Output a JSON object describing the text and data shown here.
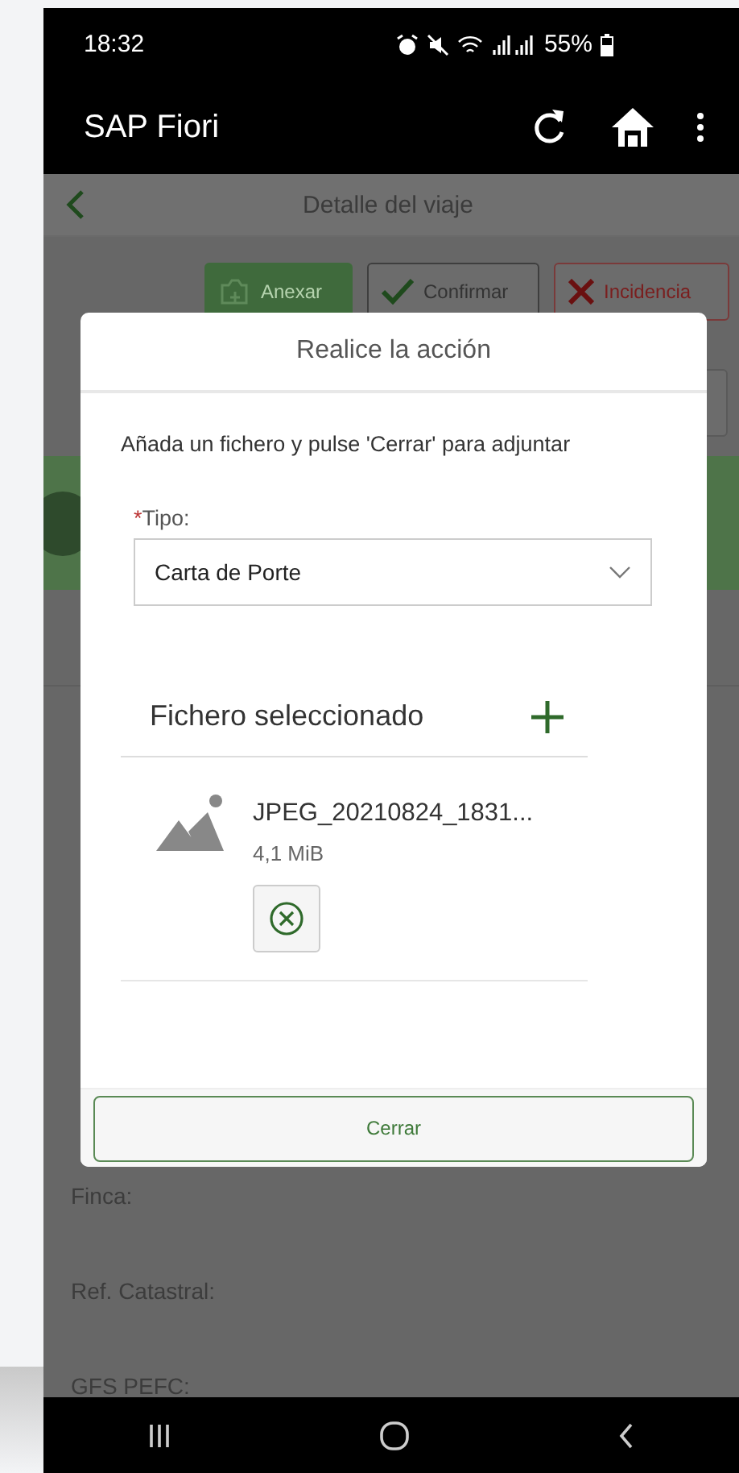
{
  "status_bar": {
    "time": "18:32",
    "battery": "55%"
  },
  "app_bar": {
    "title": "SAP Fiori"
  },
  "page": {
    "title": "Detalle del viaje",
    "actions": [
      {
        "label": "Anexar",
        "kind": "attach"
      },
      {
        "label": "Confirmar",
        "kind": "confirm"
      },
      {
        "label": "Incidencia",
        "kind": "incident"
      }
    ],
    "fields": [
      {
        "label": "Finca:"
      },
      {
        "label": "Ref. Catastral:"
      },
      {
        "label": "GFS PEFC:"
      }
    ]
  },
  "dialog": {
    "title": "Realice la acción",
    "instruction": "Añada un fichero y pulse 'Cerrar' para adjuntar",
    "field": {
      "required_mark": "*",
      "label": "Tipo:",
      "value": "Carta de Porte"
    },
    "upload": {
      "heading": "Fichero seleccionado",
      "files": [
        {
          "name": "JPEG_20210824_1831...",
          "size": "4,1 MiB"
        }
      ]
    },
    "close_button": "Cerrar"
  }
}
